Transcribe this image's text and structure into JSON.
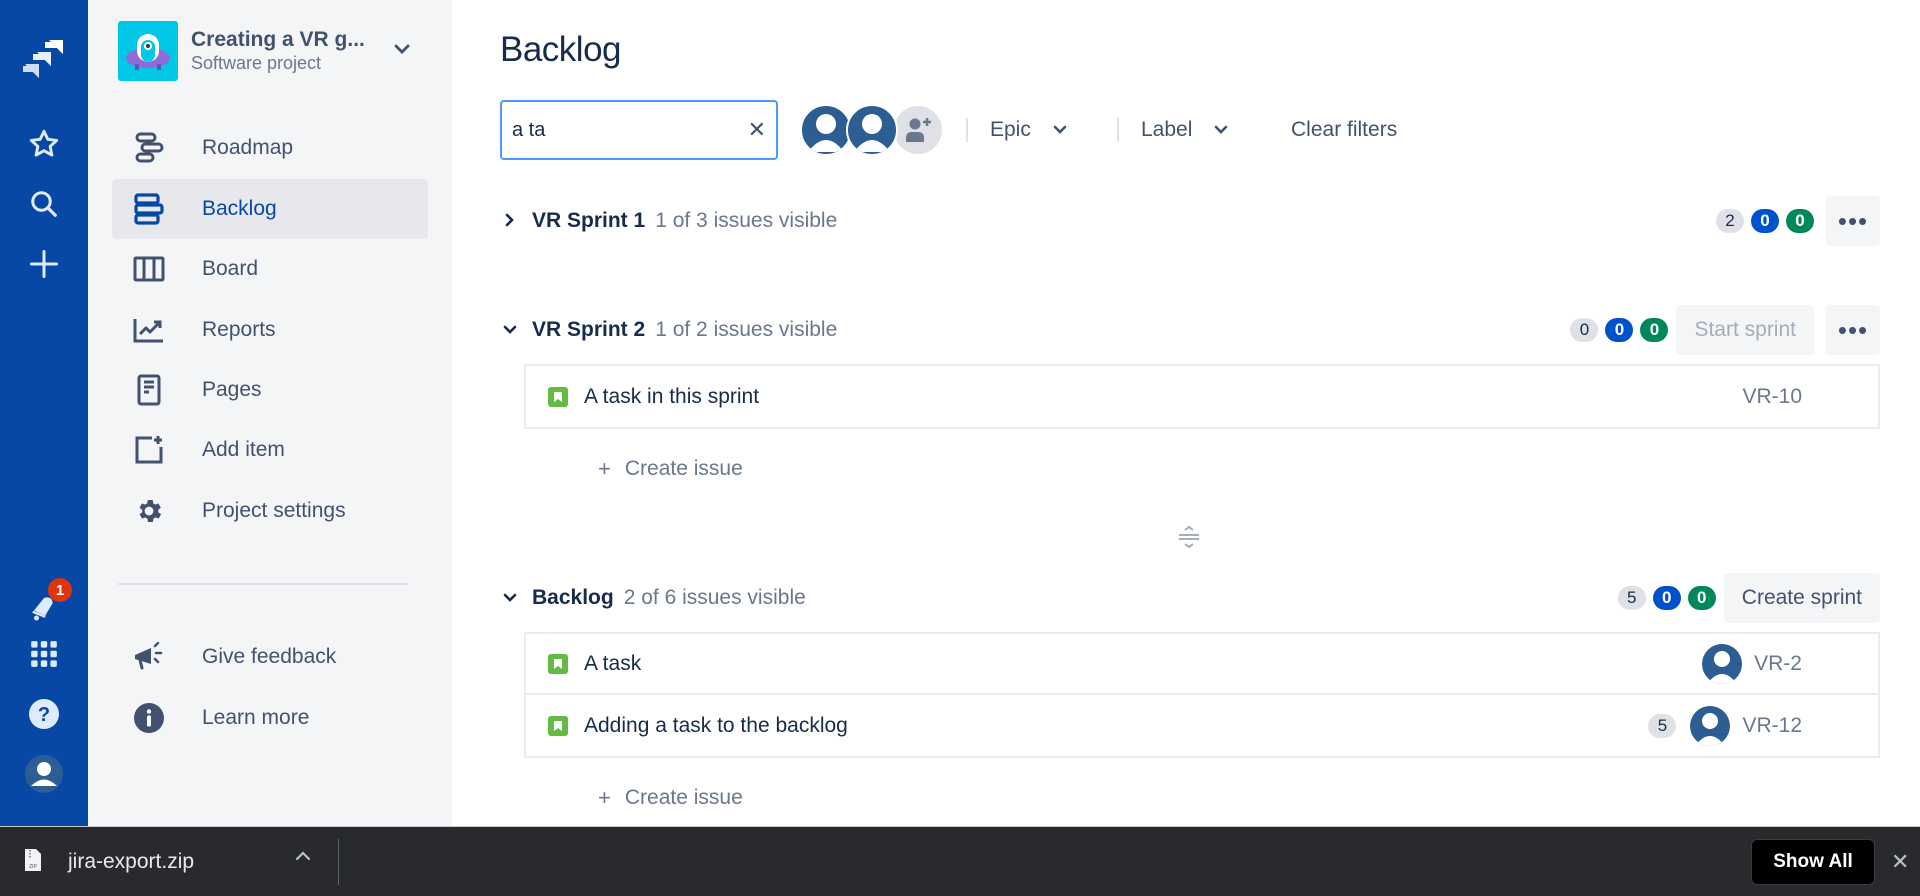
{
  "global_nav": {
    "icons": [
      "jira-logo-icon",
      "star-icon",
      "search-icon",
      "plus-icon",
      "notification-icon",
      "app-switcher-icon",
      "help-icon",
      "profile-avatar-icon"
    ],
    "notification_count": "1",
    "brand_color": "#0747a6"
  },
  "sidebar": {
    "project_name": "Creating a VR g...",
    "project_type": "Software project",
    "items": [
      {
        "label": "Roadmap",
        "icon": "roadmap-icon",
        "active": false
      },
      {
        "label": "Backlog",
        "icon": "backlog-icon",
        "active": true
      },
      {
        "label": "Board",
        "icon": "board-icon",
        "active": false
      },
      {
        "label": "Reports",
        "icon": "reports-icon",
        "active": false
      },
      {
        "label": "Pages",
        "icon": "pages-icon",
        "active": false
      },
      {
        "label": "Add item",
        "icon": "add-item-icon",
        "active": false
      },
      {
        "label": "Project settings",
        "icon": "gear-icon",
        "active": false
      }
    ],
    "footer_items": [
      {
        "label": "Give feedback",
        "icon": "megaphone-icon"
      },
      {
        "label": "Learn more",
        "icon": "info-icon"
      }
    ]
  },
  "main": {
    "title": "Backlog",
    "search": {
      "value": "a ta",
      "placeholder": ""
    },
    "filters": {
      "epic": "Epic",
      "label": "Label",
      "clear": "Clear filters"
    },
    "sprints": [
      {
        "name": "VR Sprint 1",
        "visible": "1 of 3 issues visible",
        "expanded": false,
        "counts": {
          "todo": "2",
          "in_progress": "0",
          "done": "0"
        },
        "issues": []
      },
      {
        "name": "VR Sprint 2",
        "visible": "1 of 2 issues visible",
        "expanded": true,
        "counts": {
          "todo": "0",
          "in_progress": "0",
          "done": "0"
        },
        "action": "Start sprint",
        "issues": [
          {
            "summary": "A task in this sprint",
            "key": "VR-10",
            "points": null,
            "assignee": false
          }
        ],
        "create_label": "Create issue"
      }
    ],
    "backlog": {
      "name": "Backlog",
      "visible": "2 of 6 issues visible",
      "expanded": true,
      "counts": {
        "todo": "5",
        "in_progress": "0",
        "done": "0"
      },
      "action": "Create sprint",
      "issues": [
        {
          "summary": "A task",
          "key": "VR-2",
          "points": null,
          "assignee": true
        },
        {
          "summary": "Adding a task to the backlog",
          "key": "VR-12",
          "points": "5",
          "assignee": true
        }
      ],
      "create_label": "Create issue"
    },
    "colors": {
      "todo": "#dfe1e6",
      "in_progress": "#0052cc",
      "done": "#00875a",
      "task": "#65ba43"
    }
  },
  "download_bar": {
    "file_name": "jira-export.zip",
    "show_all": "Show All"
  }
}
